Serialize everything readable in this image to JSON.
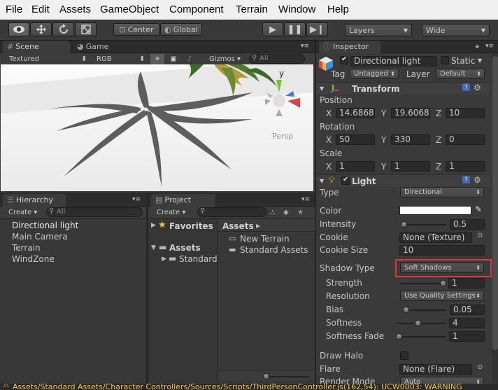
{
  "menu": [
    "File",
    "Edit",
    "Assets",
    "GameObject",
    "Component",
    "Terrain",
    "Window",
    "Help"
  ],
  "toolbar": {
    "pivot_center": "Center",
    "pivot_global": "Global",
    "layers": "Layers",
    "layout": "Wide"
  },
  "scene": {
    "tab": "Scene",
    "game_tab": "Game",
    "render_mode": "Textured",
    "color_mode": "RGB",
    "gizmos": "Gizmos",
    "search_placeholder": "All",
    "persp_label": "Persp",
    "y_label": "y"
  },
  "hierarchy": {
    "tab": "Hierarchy",
    "create": "Create",
    "search_placeholder": "All",
    "items": [
      "Directional light",
      "Main Camera",
      "Terrain",
      "WindZone"
    ]
  },
  "project": {
    "tab": "Project",
    "create": "Create",
    "favorites": "Favorites",
    "assets": "Assets",
    "standard": "Standard",
    "breadcrumb": "Assets",
    "files": [
      "New Terrain",
      "Standard Assets"
    ]
  },
  "inspector": {
    "tab": "Inspector",
    "object_name": "Directional light",
    "static_label": "Static",
    "tag_label": "Tag",
    "tag_value": "Untagged",
    "layer_label": "Layer",
    "layer_value": "Default",
    "transform": {
      "title": "Transform",
      "position_label": "Position",
      "position": {
        "x": "14.6868",
        "y": "19.60682",
        "z": "10"
      },
      "rotation_label": "Rotation",
      "rotation": {
        "x": "50",
        "y": "330",
        "z": "0"
      },
      "scale_label": "Scale",
      "scale": {
        "x": "1",
        "y": "1",
        "z": "1"
      }
    },
    "light": {
      "title": "Light",
      "type_label": "Type",
      "type_value": "Directional",
      "color_label": "Color",
      "intensity_label": "Intensity",
      "intensity_value": "0.5",
      "intensity_fraction": 0.06,
      "cookie_label": "Cookie",
      "cookie_value": "None (Texture)",
      "cookie_size_label": "Cookie Size",
      "cookie_size_value": "10",
      "shadow_type_label": "Shadow Type",
      "shadow_type_value": "Soft Shadows",
      "strength_label": "Strength",
      "strength_value": "1",
      "strength_fraction": 1.0,
      "resolution_label": "Resolution",
      "resolution_value": "Use Quality Settings",
      "bias_label": "Bias",
      "bias_value": "0.05",
      "bias_fraction": 0.025,
      "softness_label": "Softness",
      "softness_value": "4",
      "softness_fraction": 0.43,
      "softness_fade_label": "Softness Fade",
      "softness_fade_value": "1",
      "softness_fade_fraction": 0.0,
      "draw_halo_label": "Draw Halo",
      "flare_label": "Flare",
      "flare_value": "None (Flare)",
      "render_mode_label": "Render Mode",
      "render_mode_value": "Auto"
    },
    "axis_x": "X",
    "axis_y": "Y",
    "axis_z": "Z"
  },
  "status_bar": "Assets/Standard Assets/Character Controllers/Sources/Scripts/ThirdPersonController.js(162,54): UCW0003: WARNING",
  "colors": {
    "highlight_border": "#e0343a",
    "panel_bg": "#3a3a3a",
    "field_bg": "#2b2b2b",
    "light_color": "#ffffff"
  }
}
